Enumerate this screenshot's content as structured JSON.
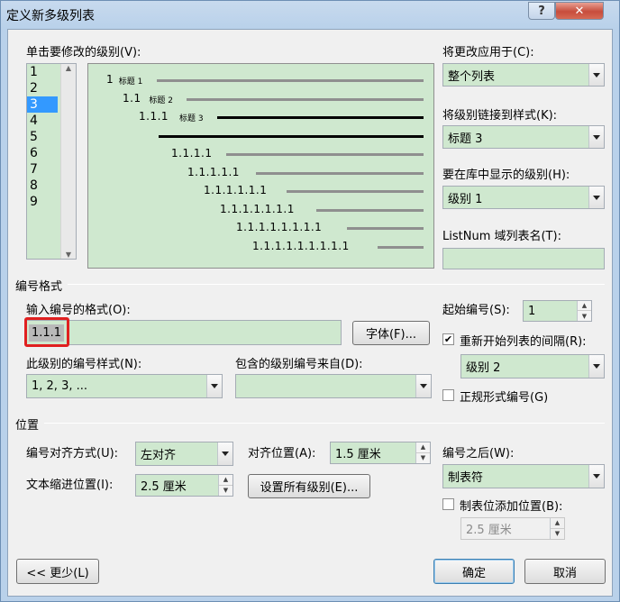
{
  "window": {
    "title": "定义新多级列表",
    "help_label": "?",
    "close_label": "✕"
  },
  "level_list": {
    "label": "单击要修改的级别(V):",
    "items": [
      "1",
      "2",
      "3",
      "4",
      "5",
      "6",
      "7",
      "8",
      "9"
    ],
    "selected": "3"
  },
  "preview": {
    "rows": [
      {
        "number": "1",
        "caption": "标题 1"
      },
      {
        "number": "1.1",
        "caption": "标题 2"
      },
      {
        "number": "1.1.1",
        "caption": "标题 3"
      },
      {
        "number": "",
        "caption": ""
      },
      {
        "number": "1.1.1.1",
        "caption": ""
      },
      {
        "number": "1.1.1.1.1",
        "caption": ""
      },
      {
        "number": "1.1.1.1.1.1",
        "caption": ""
      },
      {
        "number": "1.1.1.1.1.1.1",
        "caption": ""
      },
      {
        "number": "1.1.1.1.1.1.1.1",
        "caption": ""
      },
      {
        "number": "1.1.1.1.1.1.1.1.1",
        "caption": ""
      }
    ]
  },
  "apply_to": {
    "label": "将更改应用于(C):",
    "value": "整个列表"
  },
  "link_style": {
    "label": "将级别链接到样式(K):",
    "value": "标题 3"
  },
  "gallery_level": {
    "label": "要在库中显示的级别(H):",
    "value": "级别 1"
  },
  "listnum": {
    "label": "ListNum 域列表名(T):",
    "value": ""
  },
  "number_format": {
    "section_title": "编号格式",
    "format_label": "输入编号的格式(O):",
    "format_value": "1.1.1",
    "font_button": "字体(F)...",
    "style_label": "此级别的编号样式(N):",
    "style_value": "1, 2, 3, ...",
    "include_label": "包含的级别编号来自(D):",
    "include_value": "",
    "start_label": "起始编号(S):",
    "start_value": "1",
    "restart_label": "重新开始列表的间隔(R):",
    "restart_checked": true,
    "restart_value": "级别 2",
    "legal_label": "正规形式编号(G)",
    "legal_checked": false
  },
  "position": {
    "section_title": "位置",
    "align_label": "编号对齐方式(U):",
    "align_value": "左对齐",
    "at_label": "对齐位置(A):",
    "at_value": "1.5 厘米",
    "indent_label": "文本缩进位置(I):",
    "indent_value": "2.5 厘米",
    "set_all_button": "设置所有级别(E)...",
    "follow_label": "编号之后(W):",
    "follow_value": "制表符",
    "tab_add_label": "制表位添加位置(B):",
    "tab_add_checked": false,
    "tab_add_value": "2.5 厘米"
  },
  "footer": {
    "less_button": "<< 更少(L)",
    "ok_button": "确定",
    "cancel_button": "取消"
  },
  "colors": {
    "field_bg": "#cfe8cf",
    "highlight_border": "#e02020",
    "selection": "#3399ff"
  }
}
